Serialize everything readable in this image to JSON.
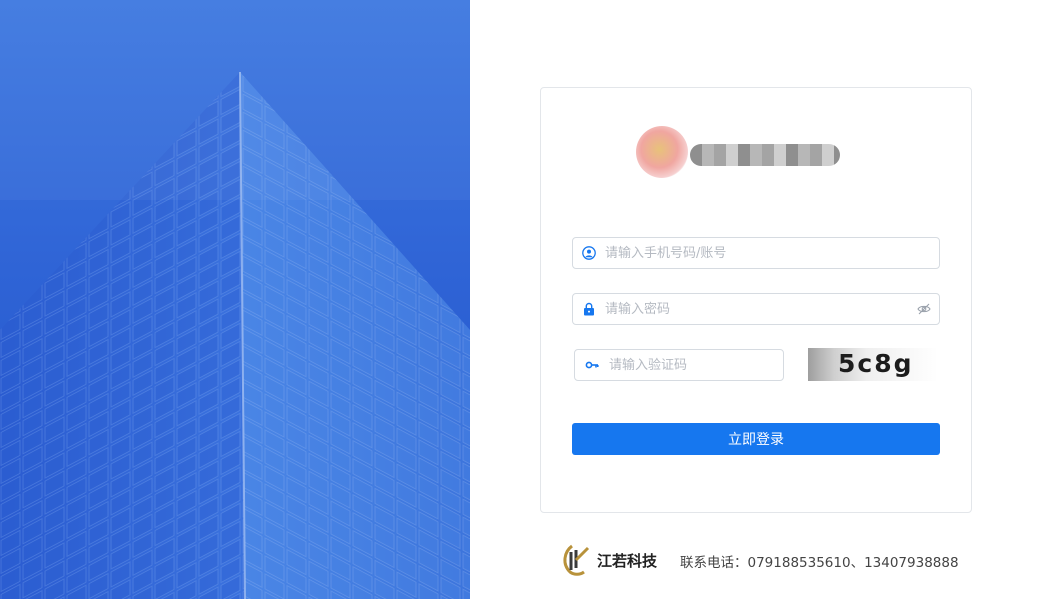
{
  "login": {
    "username_placeholder": "请输入手机号码/账号",
    "password_placeholder": "请输入密码",
    "captcha_placeholder": "请输入验证码",
    "captcha_text": "5c8g",
    "submit_label": "立即登录"
  },
  "footer": {
    "brand": "江若科技",
    "contact": "联系电话：079188535610、13407938888"
  },
  "icons": {
    "user": "user-icon",
    "lock": "lock-icon",
    "key": "key-icon",
    "eye_off": "eye-off-icon"
  },
  "colors": {
    "primary": "#1677ef",
    "hero_blue": "#2f64d6",
    "border": "#d6dbe1"
  }
}
